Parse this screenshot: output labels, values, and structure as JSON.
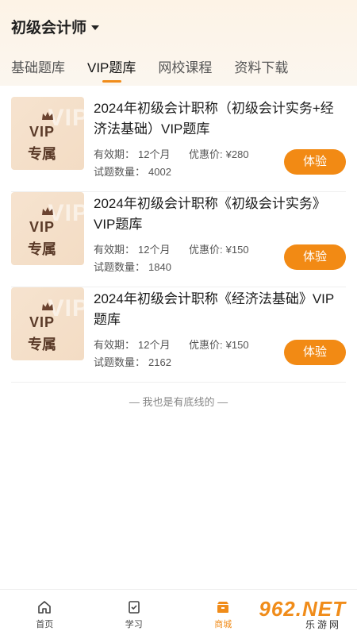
{
  "header": {
    "exam_selector": "初级会计师"
  },
  "tabs": [
    {
      "label": "基础题库",
      "active": false
    },
    {
      "label": "VIP题库",
      "active": true
    },
    {
      "label": "网校课程",
      "active": false
    },
    {
      "label": "资料下载",
      "active": false
    }
  ],
  "cover": {
    "ghost": "VIP",
    "line1": "VIP",
    "line2": "专属"
  },
  "labels": {
    "validity": "有效期：",
    "price": "优惠价:",
    "count": "试题数量："
  },
  "items": [
    {
      "title": "2024年初级会计职称（初级会计实务+经济法基础）VIP题库",
      "validity": "12个月",
      "price": "¥280",
      "count": "4002",
      "button": "体验"
    },
    {
      "title": "2024年初级会计职称《初级会计实务》VIP题库",
      "validity": "12个月",
      "price": "¥150",
      "count": "1840",
      "button": "体验"
    },
    {
      "title": "2024年初级会计职称《经济法基础》VIP题库",
      "validity": "12个月",
      "price": "¥150",
      "count": "2162",
      "button": "体验"
    }
  ],
  "end_note": "— 我也是有底线的 —",
  "bottom_nav": [
    {
      "label": "首页",
      "icon": "home-icon",
      "active": false
    },
    {
      "label": "学习",
      "icon": "study-icon",
      "active": false
    },
    {
      "label": "商城",
      "icon": "store-icon",
      "active": true
    },
    {
      "label": "",
      "icon": "mine-icon",
      "active": false
    }
  ],
  "watermark": {
    "big": "962.NET",
    "small": "乐游网"
  },
  "colors": {
    "accent": "#f08c1a",
    "button": "#f28a14",
    "cover_bg": "#f6e3cf"
  }
}
